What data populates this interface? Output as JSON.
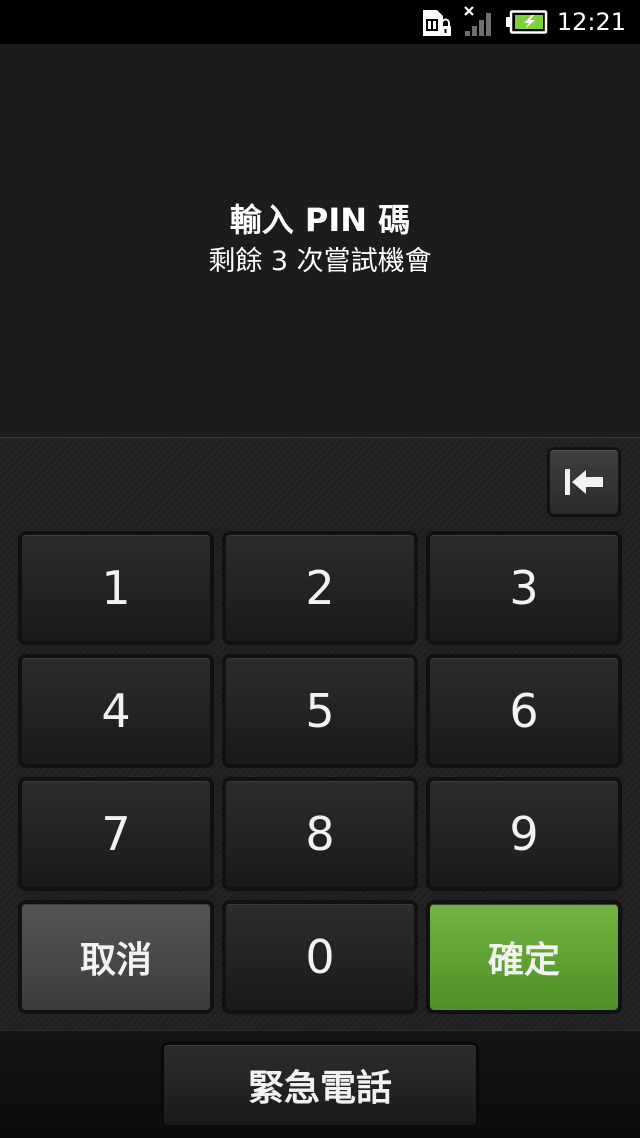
{
  "status_bar": {
    "time": "12:21",
    "icons": [
      "sim-card-locked-icon",
      "no-signal-icon",
      "battery-charging-icon"
    ]
  },
  "prompt": {
    "title": "輸入 PIN 碼",
    "subtitle": "剩餘 3 次嘗試機會"
  },
  "keypad": {
    "backspace_icon": "backspace-icon",
    "keys": [
      "1",
      "2",
      "3",
      "4",
      "5",
      "6",
      "7",
      "8",
      "9"
    ],
    "cancel_label": "取消",
    "zero_label": "0",
    "ok_label": "確定"
  },
  "emergency_label": "緊急電話",
  "colors": {
    "ok_green": "#62a634",
    "cancel_gray": "#4a4a4a",
    "battery_green": "#7fd13b"
  }
}
